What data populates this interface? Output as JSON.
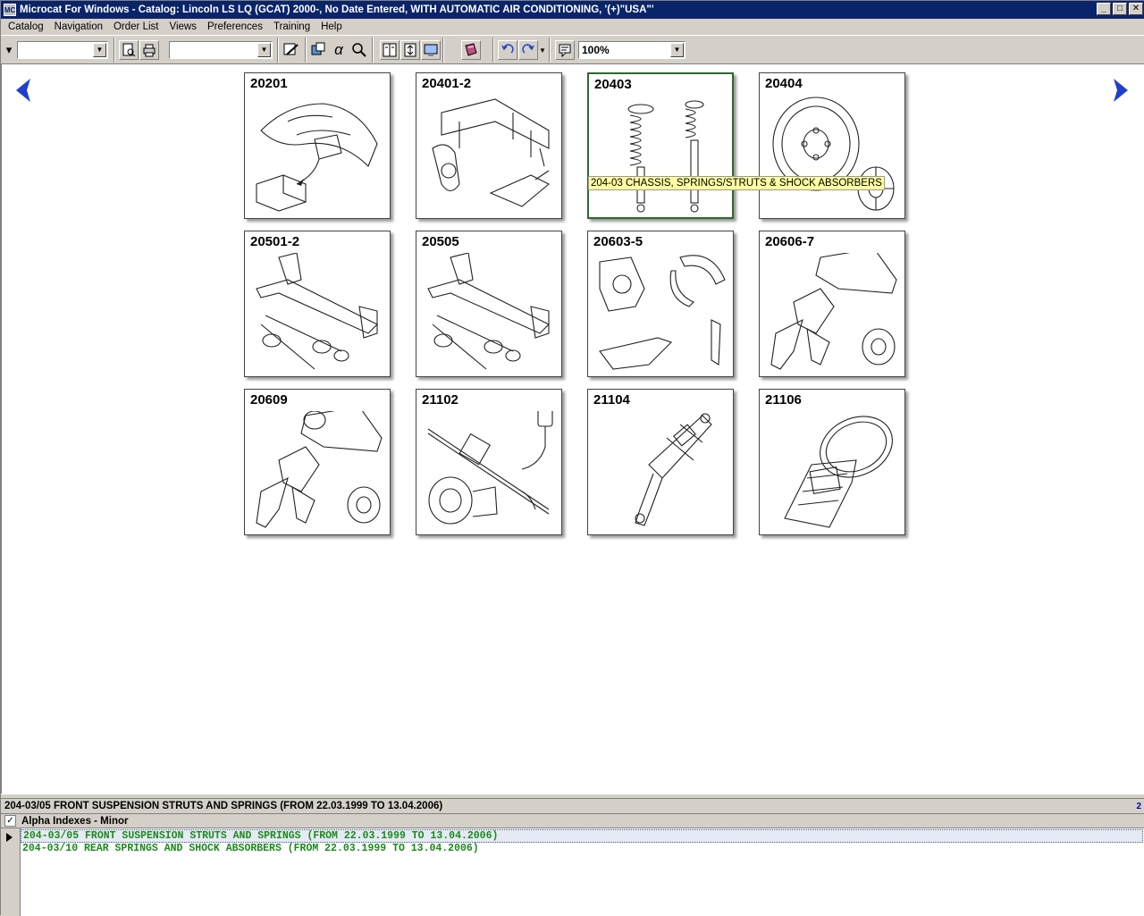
{
  "window": {
    "title": "Microcat For Windows - Catalog: Lincoln LS LQ (GCAT) 2000-, No Date Entered, WITH AUTOMATIC AIR CONDITIONING, '(+)\"USA\"'"
  },
  "menu": [
    "Catalog",
    "Navigation",
    "Order List",
    "Views",
    "Preferences",
    "Training",
    "Help"
  ],
  "toolbar": {
    "zoom": "100%"
  },
  "tiles": [
    {
      "code": "20201",
      "icon": "heat-shield-bracket"
    },
    {
      "code": "20401-2",
      "icon": "front-subframe-knuckle"
    },
    {
      "code": "20403",
      "icon": "struts-shock-absorbers"
    },
    {
      "code": "20404",
      "icon": "wheel-hubcap"
    },
    {
      "code": "20501-2",
      "icon": "rear-axle-driveshaft"
    },
    {
      "code": "20505",
      "icon": "rear-axle-driveshaft"
    },
    {
      "code": "20603-5",
      "icon": "brake-shoes-handbrake"
    },
    {
      "code": "20606-7",
      "icon": "brake-pedal-booster"
    },
    {
      "code": "20609",
      "icon": "brake-pedal-booster"
    },
    {
      "code": "21102",
      "icon": "steering-rack-pump"
    },
    {
      "code": "21104",
      "icon": "steering-column"
    },
    {
      "code": "21106",
      "icon": "steering-wheel"
    }
  ],
  "tooltip": "204-03  CHASSIS, SPRINGS/STRUTS & SHOCK ABSORBERS",
  "bottom": {
    "header": "204-03/05  FRONT SUSPENSION STRUTS AND SPRINGS (FROM 22.03.1999 TO 13.04.2006)",
    "count": "2",
    "filter_label": "Alpha Indexes - Minor",
    "rows": [
      "204-03/05  FRONT SUSPENSION STRUTS AND SPRINGS (FROM 22.03.1999 TO 13.04.2006)",
      "204-03/10  REAR SPRINGS AND SHOCK ABSORBERS (FROM 22.03.1999 TO 13.04.2006)"
    ]
  },
  "colors": {
    "titlebar": "#0a246a",
    "row_text": "#1a8a1a",
    "nav_arrow": "#1f3fd0",
    "selected_tile_border": "#2a6a2a",
    "tooltip_bg": "#ffffa0"
  }
}
